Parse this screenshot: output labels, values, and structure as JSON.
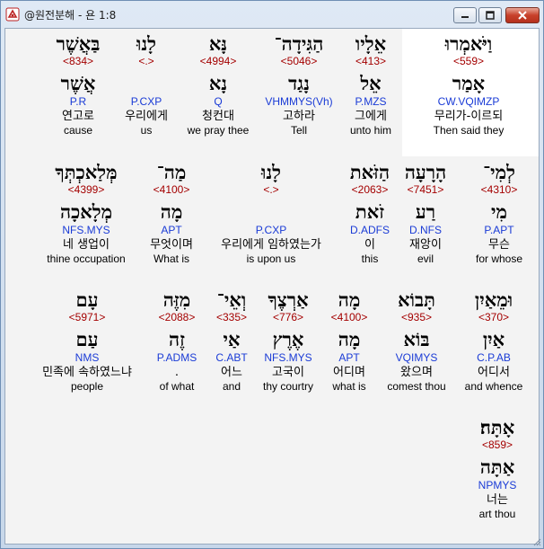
{
  "window": {
    "title": "@원전분해 - 욘 1:8"
  },
  "verse": {
    "rows": [
      {
        "words": [
          {
            "hebrew": "וַיֹּאמְרוּ",
            "strong": "<559>",
            "lemma": "אָמַר",
            "code": "CW.VQIMZP",
            "korean": "무리가-이르되",
            "english": "Then said they",
            "highlight": true
          },
          {
            "hebrew": "אֵלָיו",
            "strong": "<413>",
            "lemma": "אֵל",
            "code": "P.MZS",
            "korean": "그에게",
            "english": "unto him"
          },
          {
            "hebrew": "הַגִּידָה־",
            "strong": "<5046>",
            "lemma": "נָגַד",
            "code": "VHMMYS(Vh)",
            "korean": "고하라",
            "english": "Tell"
          },
          {
            "hebrew": "נָּא",
            "strong": "<4994>",
            "lemma": "נָא",
            "code": "Q",
            "korean": "청컨대",
            "english": "we pray thee"
          },
          {
            "hebrew": "לָנוּ",
            "strong": "<.>",
            "lemma": "",
            "code": "P.CXP",
            "korean": "우리에게",
            "english": "us"
          },
          {
            "hebrew": "בַּאֲשֶׁר",
            "strong": "<834>",
            "lemma": "אֲשֶׁר",
            "code": "P.R",
            "korean": "연고로",
            "english": "cause"
          }
        ]
      },
      {
        "words": [
          {
            "hebrew": "לְמִי־",
            "strong": "<4310>",
            "lemma": "מִי",
            "code": "P.APT",
            "korean": "무슨",
            "english": "for whose"
          },
          {
            "hebrew": "הָרָעָה",
            "strong": "<7451>",
            "lemma": "רַע",
            "code": "D.NFS",
            "korean": "재앙이",
            "english": "evil"
          },
          {
            "hebrew": "הַזֹּאת",
            "strong": "<2063>",
            "lemma": "זֹאת",
            "code": "D.ADFS",
            "korean": "이",
            "english": "this"
          },
          {
            "hebrew": "לָנוּ",
            "strong": "<.>",
            "lemma": "",
            "code": "P.CXP",
            "korean": "우리에게 임하였는가",
            "english": "is upon us"
          },
          {
            "hebrew": "מַה־",
            "strong": "<4100>",
            "lemma": "מָה",
            "code": "APT",
            "korean": "무엇이며",
            "english": "What is"
          },
          {
            "hebrew": "מְּלַאכְתְּךָ",
            "strong": "<4399>",
            "lemma": "מְלָאכָה",
            "code": "NFS.MYS",
            "korean": "네 생업이",
            "english": "thine occupation"
          }
        ]
      },
      {
        "words": [
          {
            "hebrew": "וּמֵאַיִן",
            "strong": "<370>",
            "lemma": "אַיִן",
            "code": "C.P.AB",
            "korean": "어디서",
            "english": "and whence"
          },
          {
            "hebrew": "תָּבוֹא",
            "strong": "<935>",
            "lemma": "בּוֹא",
            "code": "VQIMYS",
            "korean": "왔으며",
            "english": "comest thou"
          },
          {
            "hebrew": "מָה",
            "strong": "<4100>",
            "lemma": "מָה",
            "code": "APT",
            "korean": "어디며",
            "english": "what is"
          },
          {
            "hebrew": "אַרְצֶךָ",
            "strong": "<776>",
            "lemma": "אֶרֶץ",
            "code": "NFS.MYS",
            "korean": "고국이",
            "english": "thy courtry"
          },
          {
            "hebrew": "וְאֵי־",
            "strong": "<335>",
            "lemma": "אַי",
            "code": "C.ABT",
            "korean": "어느",
            "english": "and"
          },
          {
            "hebrew": "מִזֶּה",
            "strong": "<2088>",
            "lemma": "זֶה",
            "code": "P.ADMS",
            "korean": ".",
            "english": "of what"
          },
          {
            "hebrew": "עָם",
            "strong": "<5971>",
            "lemma": "עַם",
            "code": "NMS",
            "korean": "민족에 속하였느냐",
            "english": "people"
          }
        ]
      },
      {
        "words": [
          {
            "hebrew": "אָתָּה׃",
            "strong": "<859>",
            "lemma": "אַתָּה",
            "code": "NPMYS",
            "korean": "너는",
            "english": "art thou"
          }
        ]
      }
    ]
  },
  "colors": {
    "strong": "#a40000",
    "code": "#1a3bd6",
    "highlight": "#ffffff"
  },
  "icons": {
    "app": "app-icon",
    "minimize": "minimize-icon",
    "maximize": "maximize-icon",
    "close": "close-icon"
  }
}
